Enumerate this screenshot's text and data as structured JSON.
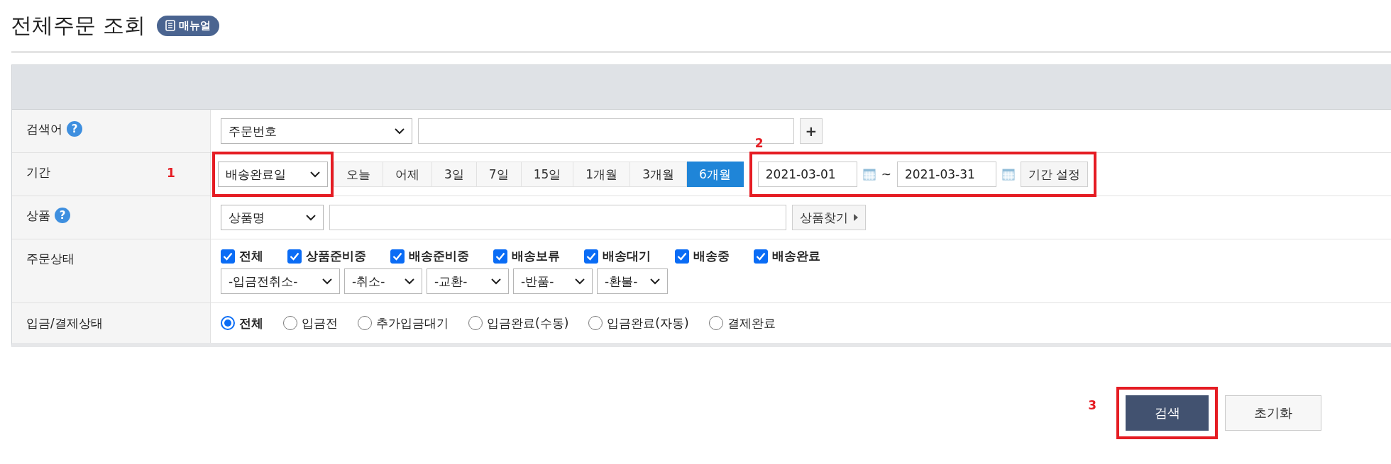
{
  "page": {
    "title": "전체주문 조회",
    "manual_button": "매뉴얼"
  },
  "search_form": {
    "keyword": {
      "label": "검색어",
      "help": "?",
      "type_select": "주문번호",
      "add_button": "+"
    },
    "period": {
      "label": "기간",
      "date_type_select": "배송완료일",
      "select_callout": "1",
      "quick_ranges": [
        {
          "label": "오늘",
          "selected": false
        },
        {
          "label": "어제",
          "selected": false
        },
        {
          "label": "3일",
          "selected": false
        },
        {
          "label": "7일",
          "selected": false
        },
        {
          "label": "15일",
          "selected": false
        },
        {
          "label": "1개월",
          "selected": false
        },
        {
          "label": "3개월",
          "selected": false
        },
        {
          "label": "6개월",
          "selected": true
        }
      ],
      "range_callout": "2",
      "start_date": "2021-03-01",
      "separator": "~",
      "end_date": "2021-03-31",
      "set_button": "기간 설정"
    },
    "product": {
      "label": "상품",
      "help": "?",
      "type_select": "상품명",
      "find_button": "상품찾기"
    },
    "order_status": {
      "label": "주문상태",
      "checkboxes": [
        {
          "label": "전체",
          "checked": true
        },
        {
          "label": "상품준비중",
          "checked": true
        },
        {
          "label": "배송준비중",
          "checked": true
        },
        {
          "label": "배송보류",
          "checked": true
        },
        {
          "label": "배송대기",
          "checked": true
        },
        {
          "label": "배송중",
          "checked": true
        },
        {
          "label": "배송완료",
          "checked": true
        }
      ],
      "dropdowns": [
        "-입금전취소-",
        "-취소-",
        "-교환-",
        "-반품-",
        "-환불-"
      ]
    },
    "payment_status": {
      "label": "입금/결제상태",
      "options": [
        {
          "label": "전체",
          "selected": true
        },
        {
          "label": "입금전",
          "selected": false
        },
        {
          "label": "추가입금대기",
          "selected": false
        },
        {
          "label": "입금완료(수동)",
          "selected": false
        },
        {
          "label": "입금완료(자동)",
          "selected": false
        },
        {
          "label": "결제완료",
          "selected": false
        }
      ]
    }
  },
  "actions": {
    "search_button": "검색",
    "search_callout": "3",
    "reset_button": "초기화"
  }
}
